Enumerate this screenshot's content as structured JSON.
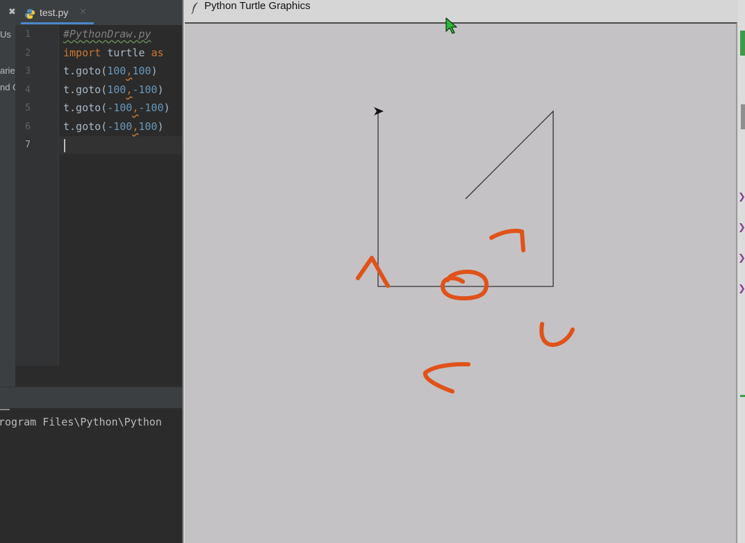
{
  "ide": {
    "tab": {
      "filename": "test.py",
      "close_glyph": "✕",
      "pin_glyph": "✖"
    },
    "project_panel_fragments": [
      "Us",
      "arie",
      "nd C"
    ],
    "line_numbers": [
      "1",
      "2",
      "3",
      "4",
      "5",
      "6",
      "7"
    ],
    "code_lines": [
      [
        {
          "t": "#PythonDraw.py",
          "c": "cm"
        }
      ],
      [
        {
          "t": "import",
          "c": "kw"
        },
        {
          "t": " turtle ",
          "c": ""
        },
        {
          "t": "as",
          "c": "kw"
        }
      ],
      [
        {
          "t": "t.goto(",
          "c": ""
        },
        {
          "t": "100",
          "c": "num"
        },
        {
          "t": ",",
          "c": "comma"
        },
        {
          "t": "100",
          "c": "num"
        },
        {
          "t": ")",
          "c": ""
        }
      ],
      [
        {
          "t": "t.goto(",
          "c": ""
        },
        {
          "t": "100",
          "c": "num"
        },
        {
          "t": ",",
          "c": "comma"
        },
        {
          "t": "-100",
          "c": "num"
        },
        {
          "t": ")",
          "c": ""
        }
      ],
      [
        {
          "t": "t.goto(",
          "c": ""
        },
        {
          "t": "-100",
          "c": "num"
        },
        {
          "t": ",",
          "c": "comma"
        },
        {
          "t": "-100",
          "c": "num"
        },
        {
          "t": ")",
          "c": ""
        }
      ],
      [
        {
          "t": "t.goto(",
          "c": ""
        },
        {
          "t": "-100",
          "c": "num"
        },
        {
          "t": ",",
          "c": "comma"
        },
        {
          "t": "100",
          "c": "num"
        },
        {
          "t": ")",
          "c": ""
        }
      ],
      []
    ],
    "run_output": "rogram Files\\Python\\Python"
  },
  "turtle_window": {
    "title": "Python Turtle Graphics",
    "icon": "feather-icon",
    "path_points": [
      [
        0,
        0
      ],
      [
        100,
        100
      ],
      [
        100,
        -100
      ],
      [
        -100,
        -100
      ],
      [
        -100,
        100
      ]
    ],
    "turtle_heading": "east",
    "annotation_color": "#e0521a",
    "line_color": "#333333"
  },
  "colors": {
    "ide_bg": "#2b2b2b",
    "keyword": "#cc7832",
    "number": "#6897bb",
    "comment": "#808080",
    "canvas_bg": "#c4c2c4",
    "cursor_green": "#2fb83a"
  }
}
